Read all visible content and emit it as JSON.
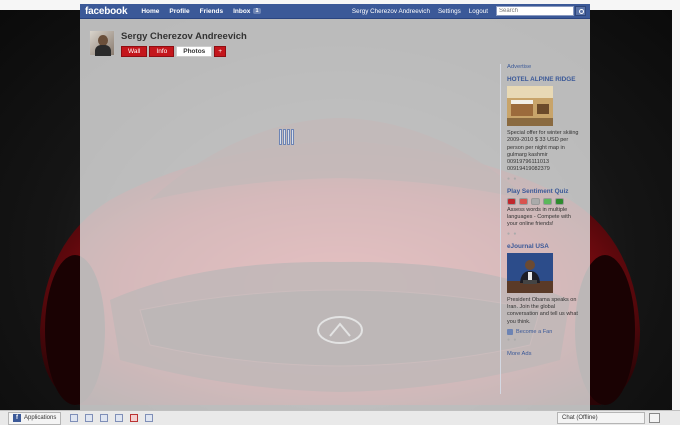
{
  "topbar": {
    "logo": "facebook",
    "nav": [
      "Home",
      "Profile",
      "Friends",
      "Inbox"
    ],
    "inbox_count": "1",
    "right_links": [
      "Sergy Cherezov Andreevich",
      "Settings",
      "Logout"
    ],
    "search_placeholder": "Search",
    "color": "#3b5998"
  },
  "profile": {
    "name": "Sergy Cherezov Andreevich",
    "tabs": [
      "Wall",
      "Info",
      "Photos"
    ],
    "active_tab": "Photos",
    "more_tab_icon": "plus-icon"
  },
  "sidebar": {
    "advertise": "Advertise",
    "ads": [
      {
        "title": "HOTEL ALPINE RIDGE",
        "text": "Special offer for winter skiiing 2009-2010 $ 33 USD per person per night map in gulmarg kashmir 00919796111013 00919419082379"
      },
      {
        "title": "Play Sentiment Quiz",
        "text": "Assess words in multiple languages - Compete with your online friends!"
      },
      {
        "title": "eJournal USA",
        "text": "President Obama speaks on Iran. Join the global conversation and tell us what you think.",
        "fan_label": "Become a Fan"
      }
    ],
    "more_ads": "More Ads"
  },
  "bottombar": {
    "applications": "Applications",
    "chat": "Chat (Offline)"
  },
  "colors": {
    "facebook_blue": "#3b5998",
    "tab_red": "#c4161c",
    "car_red": "#b3141c"
  }
}
